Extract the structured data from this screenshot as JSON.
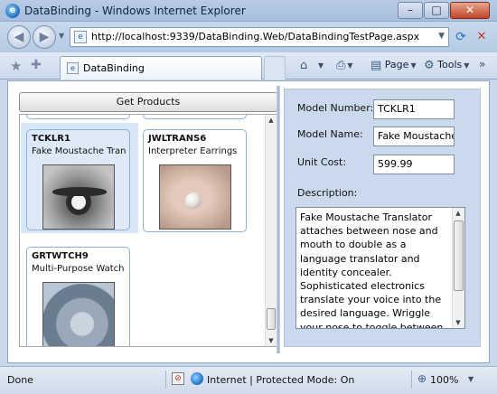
{
  "window": {
    "title": "DataBinding - Windows Internet Explorer"
  },
  "address_bar": {
    "url": "http://localhost:9339/DataBinding.Web/DataBindingTestPage.aspx"
  },
  "tab": {
    "label": "DataBinding"
  },
  "command_bar": {
    "page_label": "Page",
    "tools_label": "Tools"
  },
  "page": {
    "get_products_label": "Get Products",
    "products": [
      {
        "model_number": "TCKLR1",
        "model_name": "Fake Moustache Tran",
        "selected": true
      },
      {
        "model_number": "JWLTRANS6",
        "model_name": "Interpreter Earrings",
        "selected": false
      },
      {
        "model_number": "GRTWTCH9",
        "model_name": "Multi-Purpose Watch",
        "selected": false
      }
    ],
    "details": {
      "model_number_label": "Model Number:",
      "model_number_value": "TCKLR1",
      "model_name_label": "Model Name:",
      "model_name_value": "Fake Moustache",
      "unit_cost_label": "Unit Cost:",
      "unit_cost_value": "599.99",
      "description_label": "Description:",
      "description_value": "Fake Moustache Translator attaches between nose and mouth to double as a language translator and identity concealer. Sophisticated electronics translate your voice into the desired language. Wriggle your nose to toggle between"
    }
  },
  "status_bar": {
    "status": "Done",
    "zone": "Internet | Protected Mode: On",
    "zoom": "100%"
  }
}
